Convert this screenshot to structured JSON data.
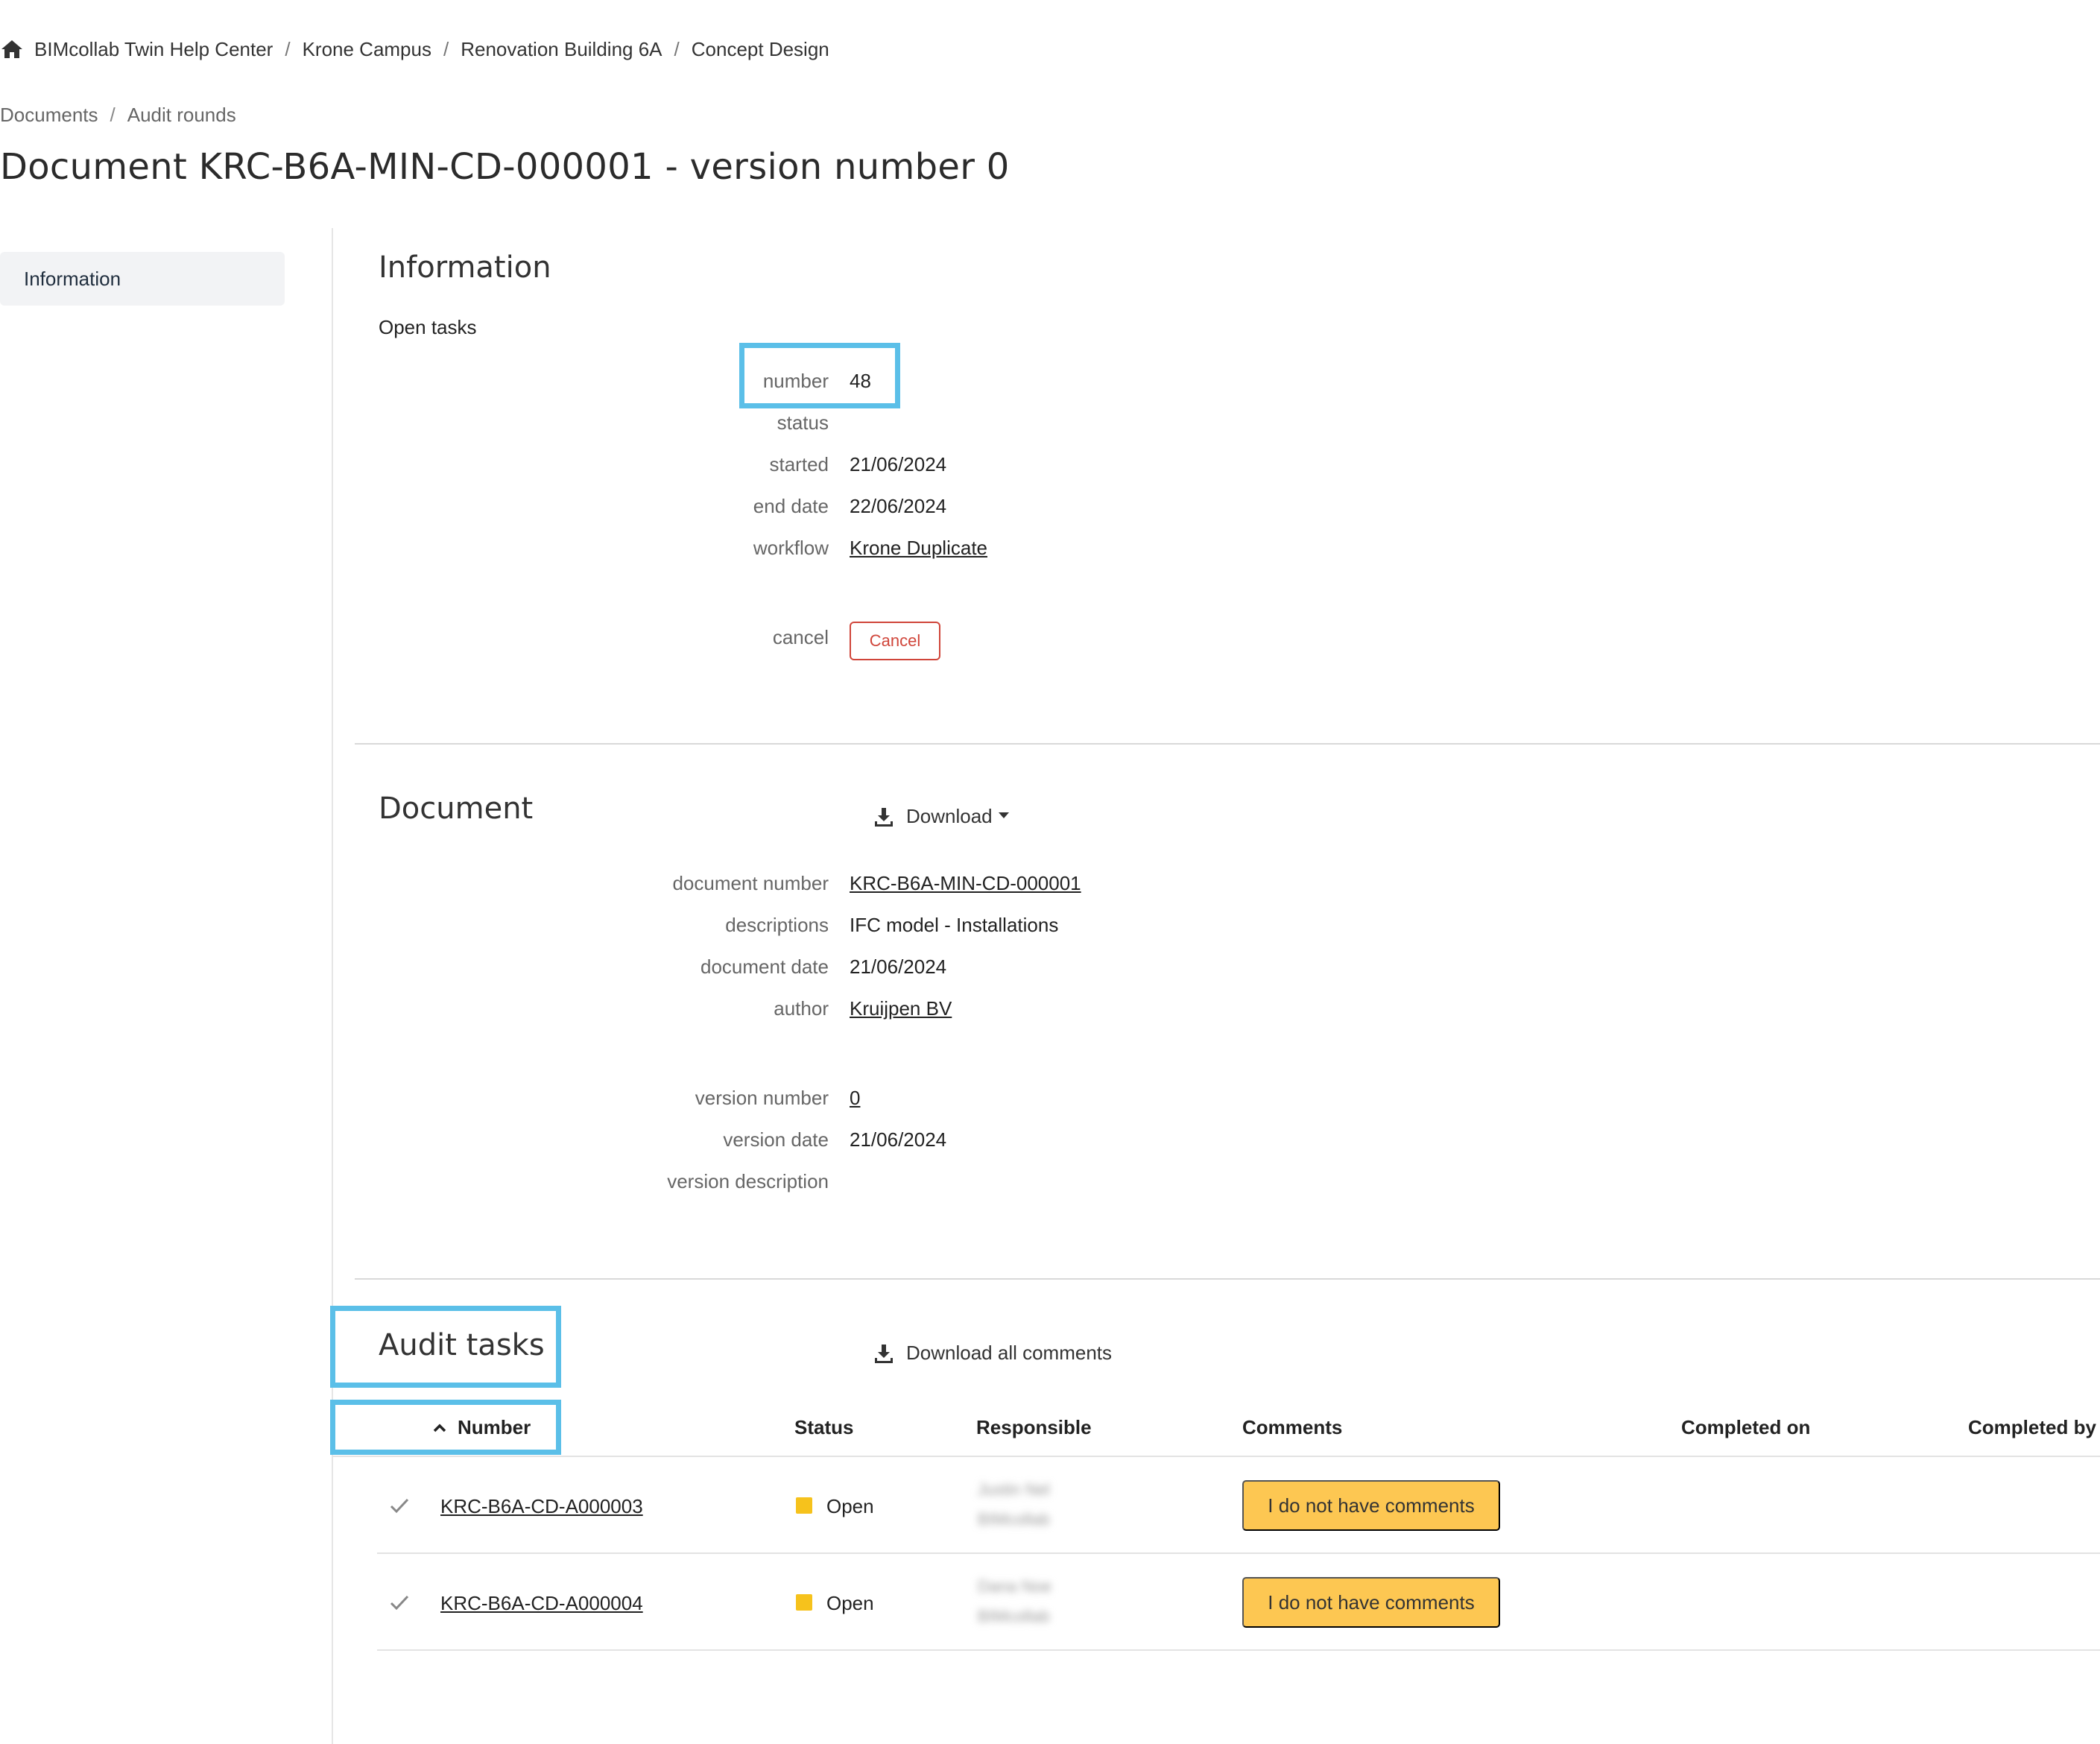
{
  "breadcrumb_top": [
    "BIMcollab Twin Help Center",
    "Krone Campus",
    "Renovation Building 6A",
    "Concept Design"
  ],
  "breadcrumb_sub": [
    "Documents",
    "Audit rounds"
  ],
  "page_title": "Document KRC-B6A-MIN-CD-000001 - version number 0",
  "sidebar": {
    "items": [
      {
        "label": "Information"
      }
    ]
  },
  "information": {
    "title": "Information",
    "subtitle": "Open tasks",
    "fields": {
      "number_label": "number",
      "number_value": "48",
      "status_label": "status",
      "status_value": "",
      "started_label": "started",
      "started_value": "21/06/2024",
      "end_date_label": "end date",
      "end_date_value": "22/06/2024",
      "workflow_label": "workflow",
      "workflow_value": "Krone Duplicate",
      "cancel_label": "cancel",
      "cancel_button": "Cancel"
    }
  },
  "document": {
    "title": "Document",
    "download_label": "Download",
    "fields": {
      "document_number_label": "document number",
      "document_number_value": "KRC-B6A-MIN-CD-000001",
      "descriptions_label": "descriptions",
      "descriptions_value": "IFC model - Installations",
      "document_date_label": "document date",
      "document_date_value": "21/06/2024",
      "author_label": "author",
      "author_value": "Kruijpen BV",
      "version_number_label": "version number",
      "version_number_value": "0",
      "version_date_label": "version date",
      "version_date_value": "21/06/2024",
      "version_description_label": "version description",
      "version_description_value": ""
    }
  },
  "audit_tasks": {
    "title": "Audit tasks",
    "download_all_label": "Download all comments",
    "columns": [
      "Number",
      "Status",
      "Responsible",
      "Comments",
      "Completed on",
      "Completed by"
    ],
    "rows": [
      {
        "number": "KRC-B6A-CD-A000003",
        "status": "Open",
        "responsible_name": "Justin Nel",
        "responsible_org": "BIMcollab",
        "comment_button": "I do not have comments"
      },
      {
        "number": "KRC-B6A-CD-A000004",
        "status": "Open",
        "responsible_name": "Dana Noe",
        "responsible_org": "BIMcollab",
        "comment_button": "I do not have comments"
      }
    ]
  },
  "colors": {
    "accent_highlight": "#5bbfe8",
    "status_open": "#f6c21c",
    "comment_button": "#fdc752",
    "danger": "#d0453a",
    "link": "#1a5fb4"
  }
}
